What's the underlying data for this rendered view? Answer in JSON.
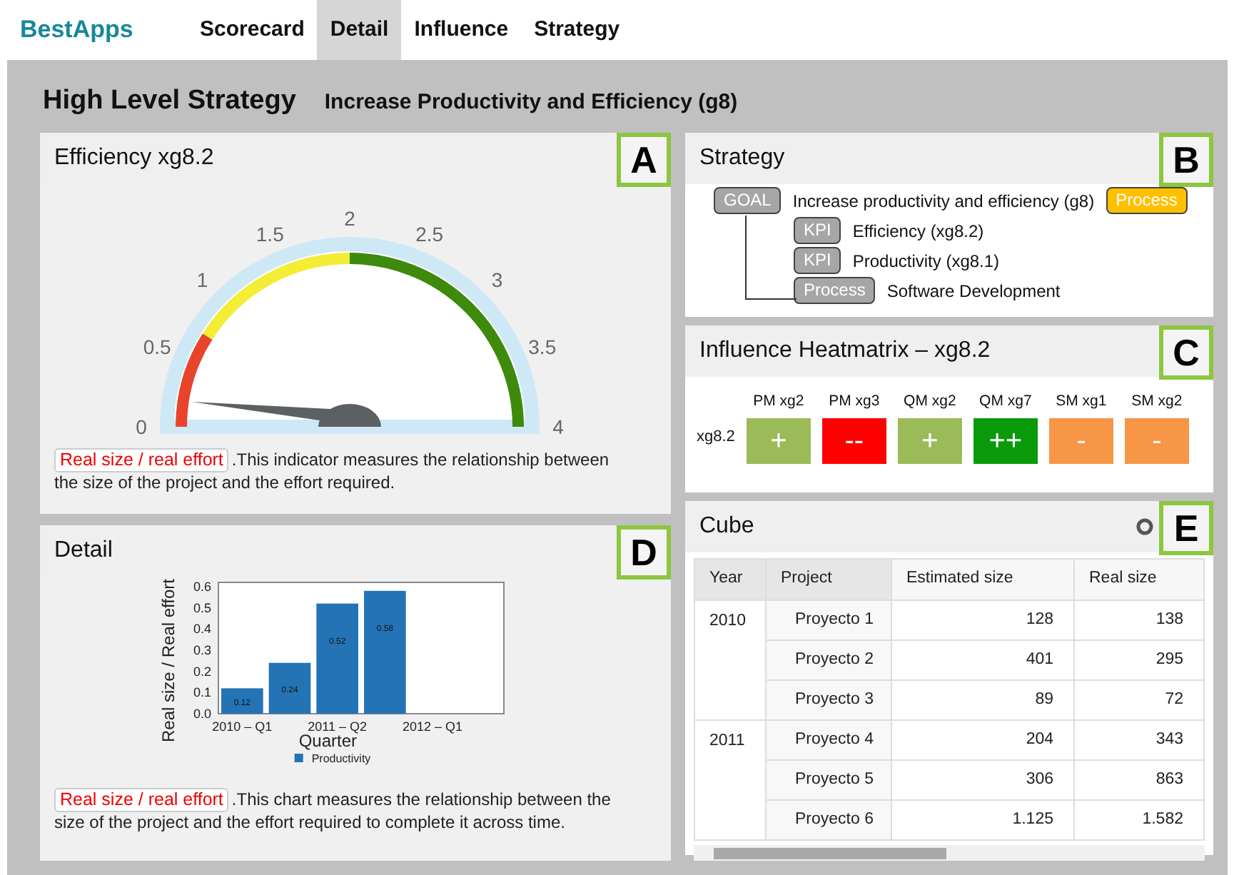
{
  "nav": {
    "brand": "BestApps",
    "tabs": [
      {
        "label": "Scorecard",
        "selected": false
      },
      {
        "label": "Detail",
        "selected": true
      },
      {
        "label": "Influence",
        "selected": false
      },
      {
        "label": "Strategy",
        "selected": false
      }
    ]
  },
  "page": {
    "title": "High Level Strategy",
    "subtitle": "Increase Productivity and Efficiency (g8)"
  },
  "efficiency": {
    "title": "Efficiency xg8.2",
    "marker": "A",
    "gauge": {
      "ticks": [
        "0",
        "0.5",
        "1",
        "1.5",
        "2",
        "2.5",
        "3",
        "3.5",
        "4"
      ],
      "bands": [
        {
          "color": "#e8442c"
        },
        {
          "color": "#f5ec36"
        },
        {
          "color": "#3d8a0c"
        }
      ]
    },
    "tag": "Real size / real effort",
    "text": ".This indicator measures the relationship between the size of the project and the effort required."
  },
  "detail": {
    "title": "Detail",
    "marker": "D",
    "chart_data": {
      "type": "bar",
      "xlabel": "Quarter",
      "ylabel": "Real size / Real effort",
      "categories": [
        "2010 – Q1",
        null,
        "2011 – Q2",
        null,
        "2012 – Q1",
        null
      ],
      "series": [
        {
          "name": "Productivity",
          "color": "#2474b5",
          "values": [
            0.12,
            0.24,
            0.52,
            0.58,
            null,
            null
          ]
        }
      ],
      "ylim": [
        0,
        0.62
      ],
      "yticks": [
        {
          "value": 0,
          "label": "0.0"
        },
        0.1,
        0.2,
        0.3,
        0.4,
        0.5,
        0.6
      ],
      "data_labels": true
    },
    "tag": "Real size / real effort",
    "text": ".This chart measures the relationship between the size of the project and the effort required to complete it across time."
  },
  "strategy": {
    "title": "Strategy",
    "marker": "B",
    "goal": {
      "tag": "GOAL",
      "label": "Increase productivity and efficiency (g8)",
      "badge": "Process",
      "children": [
        {
          "tag": "KPI",
          "label": "Efficiency (xg8.2)"
        },
        {
          "tag": "KPI",
          "label": "Productivity (xg8.1)"
        },
        {
          "tag": "Process",
          "label": "Software Development"
        }
      ]
    }
  },
  "heatmatrix": {
    "title": "Influence Heatmatrix – xg8.2",
    "marker": "C",
    "row_label": "xg8.2",
    "cells": [
      {
        "column": "PM xg2",
        "value": "+",
        "color": "#9bbb59"
      },
      {
        "column": "PM xg3",
        "value": "--",
        "color": "#ff0000"
      },
      {
        "column": "QM xg2",
        "value": "+",
        "color": "#9bbb59"
      },
      {
        "column": "QM xg7",
        "value": "++",
        "color": "#0a9a0a"
      },
      {
        "column": "SM xg1",
        "value": "-",
        "color": "#f79646"
      },
      {
        "column": "SM xg2",
        "value": "-",
        "color": "#f79646"
      }
    ]
  },
  "cube": {
    "title": "Cube",
    "marker": "E",
    "columns": [
      "Year",
      "Project",
      "Estimated size",
      "Real size"
    ],
    "groups": [
      {
        "year": "2010",
        "rows": [
          {
            "project": "Proyecto 1",
            "estimated": "128",
            "real": "138"
          },
          {
            "project": "Proyecto 2",
            "estimated": "401",
            "real": "295"
          },
          {
            "project": "Proyecto 3",
            "estimated": "89",
            "real": "72"
          }
        ]
      },
      {
        "year": "2011",
        "rows": [
          {
            "project": "Proyecto 4",
            "estimated": "204",
            "real": "343"
          },
          {
            "project": "Proyecto 5",
            "estimated": "306",
            "real": "863"
          },
          {
            "project": "Proyecto 6",
            "estimated": "1.125",
            "real": "1.582"
          }
        ]
      }
    ]
  }
}
